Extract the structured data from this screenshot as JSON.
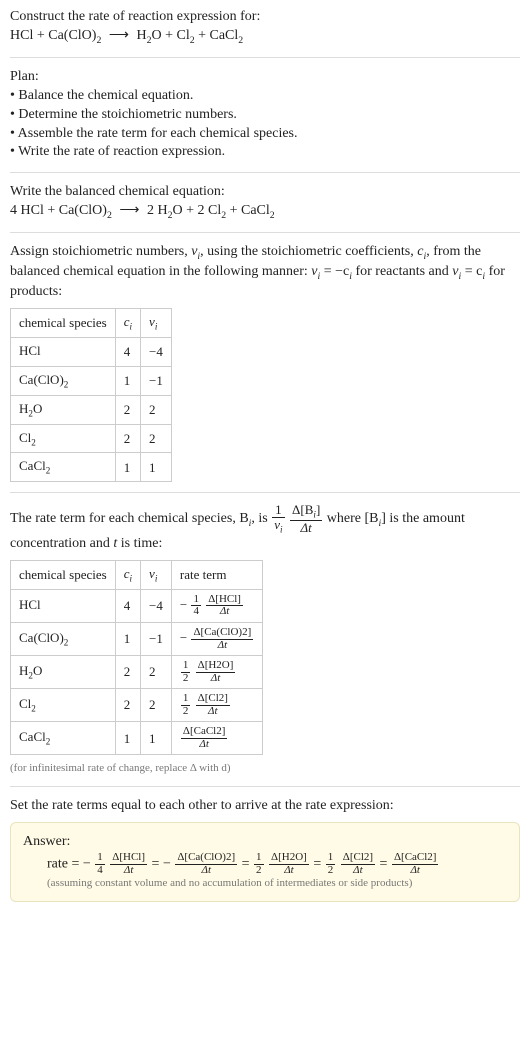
{
  "headings": {
    "construct": "Construct the rate of reaction expression for:",
    "plan": "Plan:",
    "balanced": "Write the balanced chemical equation:",
    "assign_a": "Assign stoichiometric numbers, ",
    "assign_b": ", using the stoichiometric coefficients, ",
    "assign_c": ", from the balanced chemical equation in the following manner: ",
    "assign_d": " for reactants and ",
    "assign_e": " for products:",
    "rate_term_a": "The rate term for each chemical species, B",
    "rate_term_b": ", is ",
    "rate_term_c": " where [B",
    "rate_term_d": "] is the amount concentration and ",
    "rate_term_e": " is time:",
    "infinitesimal": "(for infinitesimal rate of change, replace Δ with d)",
    "set_equal": "Set the rate terms equal to each other to arrive at the rate expression:",
    "answer": "Answer:",
    "assumption": "(assuming constant volume and no accumulation of intermediates or side products)",
    "rate_eq": "rate = ",
    "t_letter": "t"
  },
  "sym": {
    "nu_i": "ν",
    "nu_i_sub": "i",
    "c_i": "c",
    "c_i_sub": "i",
    "i_sub": "i",
    "B_sub": "i",
    "t": "t"
  },
  "plan_items": [
    "• Balance the chemical equation.",
    "• Determine the stoichiometric numbers.",
    "• Assemble the rate term for each chemical species.",
    "• Write the rate of reaction expression."
  ],
  "eq_unbalanced": {
    "lhs": "HCl + Ca(ClO)",
    "lhs2": "2",
    "arrow": "⟶",
    "rhs1": "H",
    "rhs1s": "2",
    "rhs1b": "O + Cl",
    "rhs2s": "2",
    "rhs2b": " + CaCl",
    "rhs3s": "2"
  },
  "eq_balanced": {
    "a": "4 HCl + Ca(ClO)",
    "a2": "2",
    "arrow": "⟶",
    "b": "2 H",
    "b2": "2",
    "bb": "O + 2 Cl",
    "c2": "2",
    "cc": " + CaCl",
    "d2": "2"
  },
  "nu_eq_neg": {
    "a": "ν",
    "b": "i",
    "c": " = −c",
    "d": "i"
  },
  "nu_eq_pos": {
    "a": "ν",
    "b": "i",
    "c": " = c",
    "d": "i"
  },
  "table1": {
    "headers": {
      "sp": "chemical species",
      "c": "c",
      "c_sub": "i",
      "nu": "ν",
      "nu_sub": "i"
    },
    "rows": [
      {
        "sp_a": "HCl",
        "sp_sub": "",
        "c": "4",
        "nu": "−4"
      },
      {
        "sp_a": "Ca(ClO)",
        "sp_sub": "2",
        "c": "1",
        "nu": "−1"
      },
      {
        "sp_a": "H",
        "sp_sub": "2",
        "sp_b": "O",
        "c": "2",
        "nu": "2"
      },
      {
        "sp_a": "Cl",
        "sp_sub": "2",
        "c": "2",
        "nu": "2"
      },
      {
        "sp_a": "CaCl",
        "sp_sub": "2",
        "c": "1",
        "nu": "1"
      }
    ]
  },
  "rate_frac": {
    "coef_num": "1",
    "coef_den_a": "ν",
    "coef_den_b": "i",
    "d_num_a": "Δ[B",
    "d_num_b": "i",
    "d_num_c": "]",
    "d_den": "Δt"
  },
  "table2": {
    "headers": {
      "sp": "chemical species",
      "c": "c",
      "c_sub": "i",
      "nu": "ν",
      "nu_sub": "i",
      "rt": "rate term"
    },
    "rows": [
      {
        "sp_a": "HCl",
        "sp_sub": "",
        "c": "4",
        "nu": "−4",
        "neg": "−",
        "cn": "1",
        "cd": "4",
        "num": "Δ[HCl]",
        "den": "Δt"
      },
      {
        "sp_a": "Ca(ClO)",
        "sp_sub": "2",
        "c": "1",
        "nu": "−1",
        "neg": "−",
        "cn": "",
        "cd": "",
        "num": "Δ[Ca(ClO)2]",
        "den": "Δt"
      },
      {
        "sp_a": "H",
        "sp_sub": "2",
        "sp_b": "O",
        "c": "2",
        "nu": "2",
        "neg": "",
        "cn": "1",
        "cd": "2",
        "num": "Δ[H2O]",
        "den": "Δt"
      },
      {
        "sp_a": "Cl",
        "sp_sub": "2",
        "c": "2",
        "nu": "2",
        "neg": "",
        "cn": "1",
        "cd": "2",
        "num": "Δ[Cl2]",
        "den": "Δt"
      },
      {
        "sp_a": "CaCl",
        "sp_sub": "2",
        "c": "1",
        "nu": "1",
        "neg": "",
        "cn": "",
        "cd": "",
        "num": "Δ[CaCl2]",
        "den": "Δt"
      }
    ]
  },
  "chart_data": {
    "type": "table",
    "title": "Stoichiometric coefficients and rate terms",
    "balanced_equation": "4 HCl + Ca(ClO)2 → 2 H2O + 2 Cl2 + CaCl2",
    "species": [
      "HCl",
      "Ca(ClO)2",
      "H2O",
      "Cl2",
      "CaCl2"
    ],
    "c_i": [
      4,
      1,
      2,
      2,
      1
    ],
    "nu_i": [
      -4,
      -1,
      2,
      2,
      1
    ],
    "rate_expression": "rate = -(1/4) d[HCl]/dt = - d[Ca(ClO)2]/dt = (1/2) d[H2O]/dt = (1/2) d[Cl2]/dt = d[CaCl2]/dt"
  },
  "answer_terms": [
    {
      "neg": "−",
      "cn": "1",
      "cd": "4",
      "num": "Δ[HCl]",
      "den": "Δt"
    },
    {
      "neg": "−",
      "cn": "",
      "cd": "",
      "num": "Δ[Ca(ClO)2]",
      "den": "Δt"
    },
    {
      "neg": "",
      "cn": "1",
      "cd": "2",
      "num": "Δ[H2O]",
      "den": "Δt"
    },
    {
      "neg": "",
      "cn": "1",
      "cd": "2",
      "num": "Δ[Cl2]",
      "den": "Δt"
    },
    {
      "neg": "",
      "cn": "",
      "cd": "",
      "num": "Δ[CaCl2]",
      "den": "Δt"
    }
  ],
  "eq_sep": " = "
}
